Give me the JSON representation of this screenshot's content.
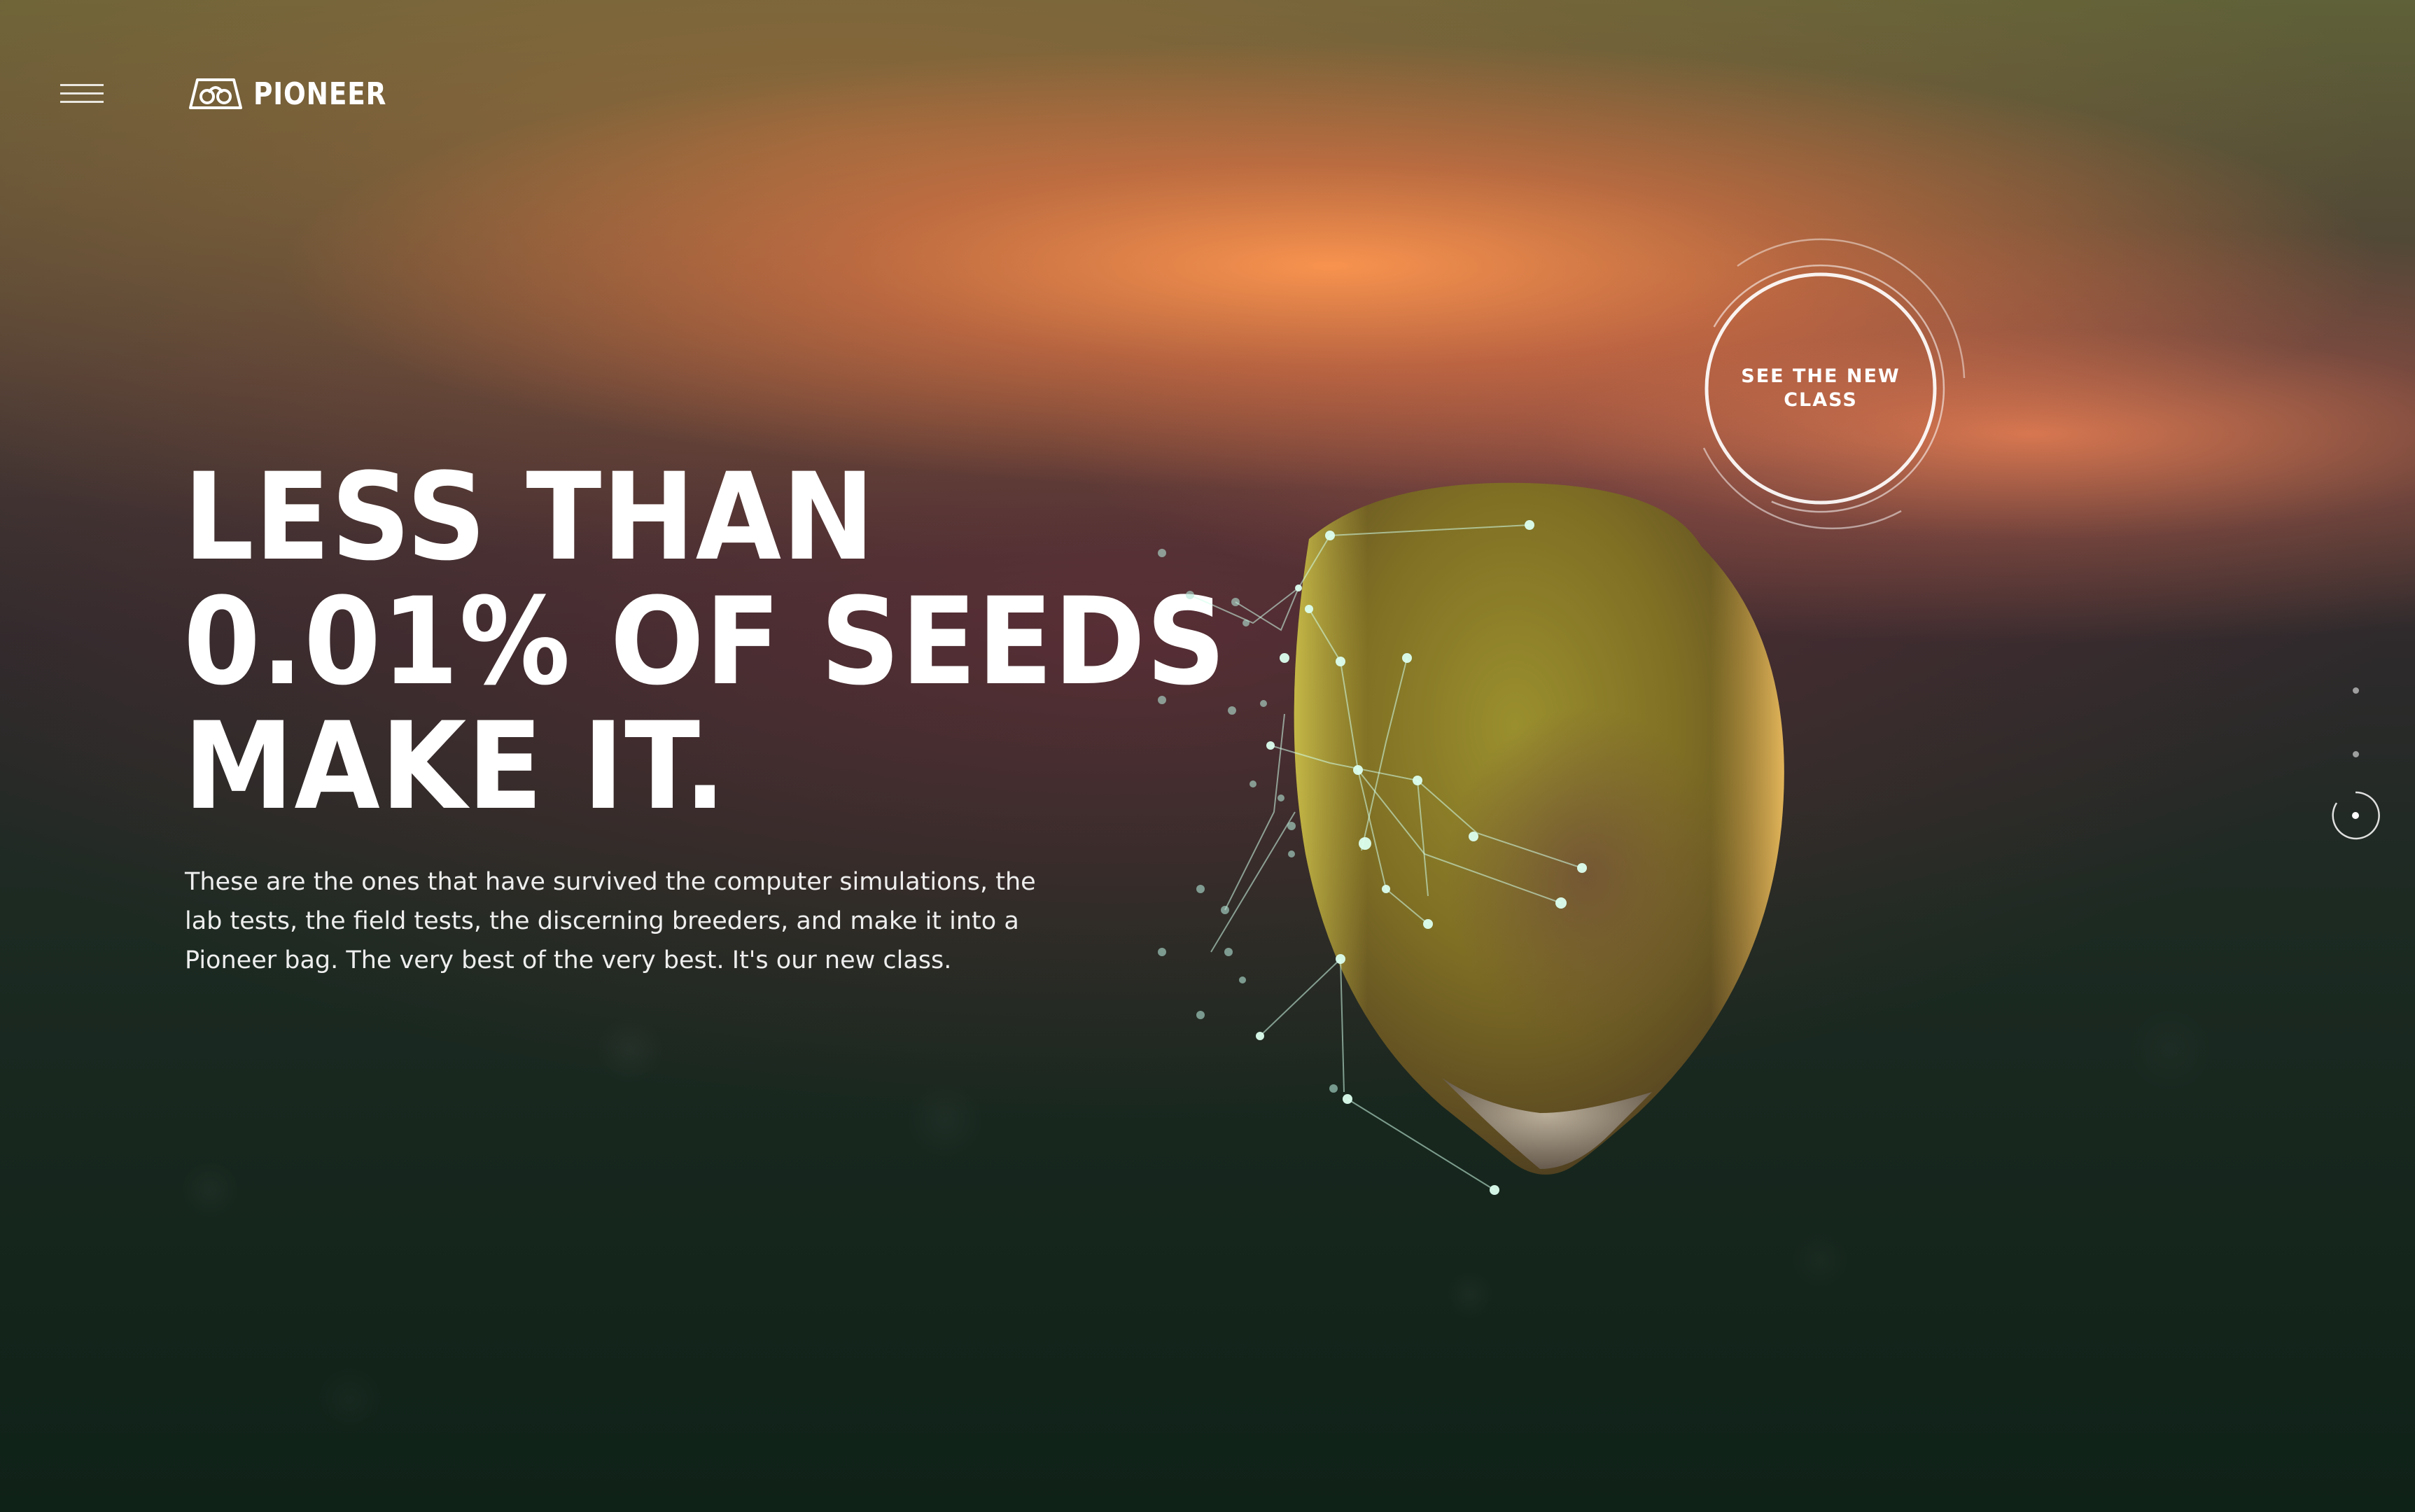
{
  "header": {
    "menu_icon": "hamburger-menu-icon",
    "logo_icon": "pioneer-logo-icon",
    "logo_text": "PIONEER"
  },
  "hero": {
    "headline_lines": [
      "LESS THAN",
      "0.01% OF SEEDS",
      "MAKE IT."
    ],
    "body_lines": [
      "These are the ones that have survived the computer simulations, the",
      "lab tests, the field tests, the discerning breeders, and make it into a",
      "Pioneer bag. The very best of the very best. It's our new class."
    ]
  },
  "cta": {
    "label_lines": [
      "SEE THE NEW",
      "CLASS"
    ]
  },
  "pager": {
    "count": 3,
    "active_index": 2
  },
  "colors": {
    "text": "#ffffff",
    "accent_orange": "#f2884f",
    "background_dark": "#0f2218"
  }
}
